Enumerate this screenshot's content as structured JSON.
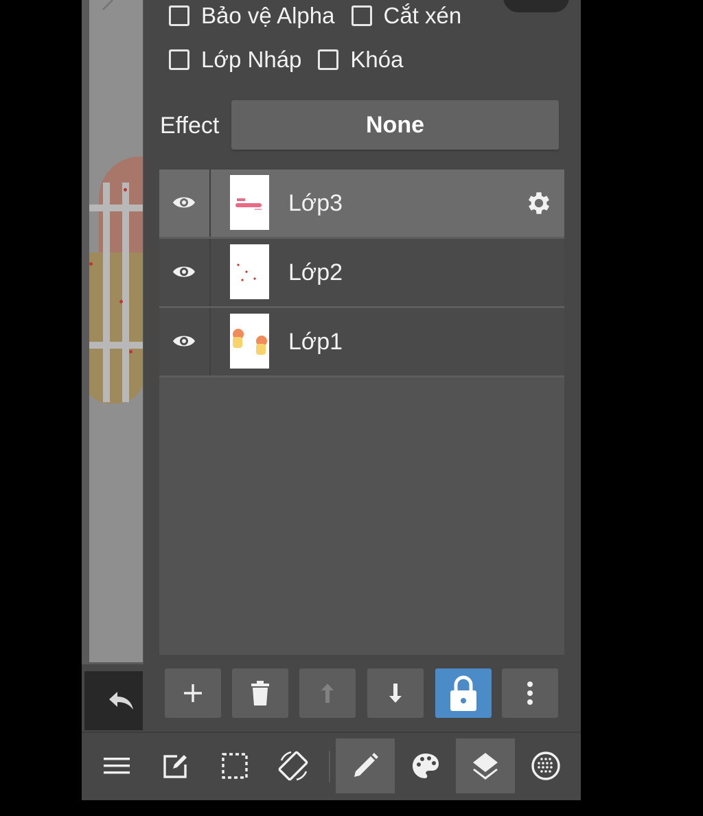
{
  "options": {
    "alpha_protect": "Bảo vệ Alpha",
    "clipping": "Cắt xén",
    "draft_layer": "Lớp Nháp",
    "lock": "Khóa"
  },
  "effect": {
    "label": "Effect",
    "value": "None"
  },
  "layers": [
    {
      "name": "Lớp3",
      "visible": true,
      "selected": true
    },
    {
      "name": "Lớp2",
      "visible": true,
      "selected": false
    },
    {
      "name": "Lớp1",
      "visible": true,
      "selected": false
    }
  ],
  "layer_tools": [
    "add-layer",
    "delete-layer",
    "move-layer-up",
    "move-layer-down",
    "lock-layer",
    "more-options"
  ],
  "bottom_nav": [
    "menu",
    "edit",
    "selection",
    "rotate",
    "brush",
    "palette",
    "layers",
    "material"
  ],
  "colors": {
    "accent": "#4a8bc8",
    "panel": "#474747",
    "selected_row": "#6c6c6c"
  }
}
